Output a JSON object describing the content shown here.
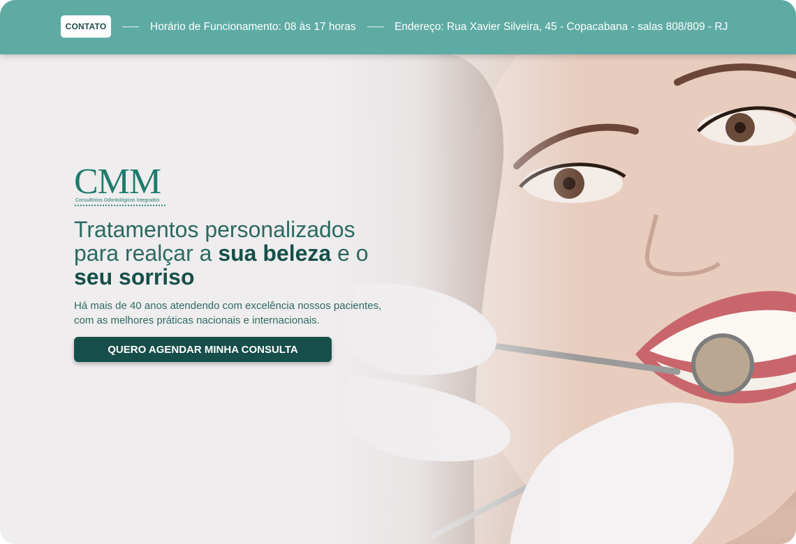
{
  "topbar": {
    "contact_label": "CONTATO",
    "hours": "Horário de Funcionamento: 08 às 17 horas",
    "address": "Endereço: Rua Xavier Silveira, 45 - Copacabana - salas 808/809 - RJ"
  },
  "logo": {
    "mark": "CMM",
    "tagline": "Consultórios Odontológicos Integrados"
  },
  "hero": {
    "headline_part1": "Tratamentos personalizados para realçar a ",
    "headline_bold1": "sua beleza",
    "headline_part2": " e o ",
    "headline_bold2": "seu sorriso",
    "description": "Há mais de 40 anos atendendo com excelência nossos pacientes, com as melhores práticas nacionais e internacionais.",
    "cta_label": "QUERO AGENDAR MINHA CONSULTA"
  },
  "colors": {
    "topbar": "#5eaba3",
    "primary": "#164f49",
    "background": "#efedee"
  }
}
